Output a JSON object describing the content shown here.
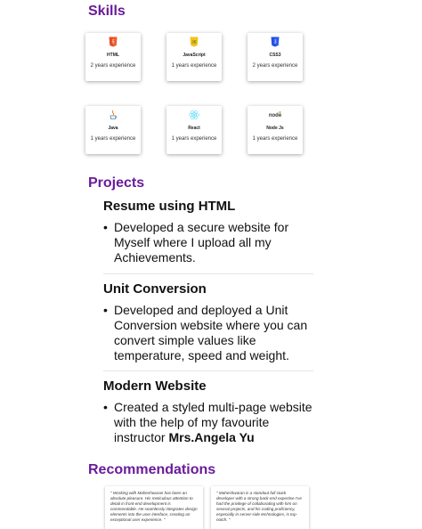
{
  "skills": {
    "title": "Skills",
    "items": [
      {
        "name": "HTML",
        "experience": "2 years experience",
        "icon": "html5-icon",
        "color": "#e44d26"
      },
      {
        "name": "JavaScript",
        "experience": "1 years experience",
        "icon": "javascript-icon",
        "color": "#f0c419"
      },
      {
        "name": "CSS3",
        "experience": "2 years experience",
        "icon": "css3-icon",
        "color": "#264de4"
      },
      {
        "name": "Java",
        "experience": "1 years experience",
        "icon": "java-icon",
        "color": "#e76f00"
      },
      {
        "name": "React",
        "experience": "1 years experience",
        "icon": "react-icon",
        "color": "#61dafb"
      },
      {
        "name": "Node Js",
        "experience": "1 years experience",
        "icon": "nodejs-icon",
        "color": "#333333"
      }
    ]
  },
  "projects": {
    "title": "Projects",
    "items": [
      {
        "title": "Resume using HTML",
        "bullet": "Developed a secure website for Myself where I upload all my Achievements."
      },
      {
        "title": "Unit Conversion",
        "bullet": "Developed and deployed a Unit Conversion website where you can convert simple values like temperature, speed and weight."
      },
      {
        "title": "Modern Website",
        "bullet": "Created a styled multi-page website with the help of my favourite instructor ",
        "bullet_bold": "Mrs.Angela Yu"
      }
    ]
  },
  "recommendations": {
    "title": "Recommendations",
    "items": [
      {
        "text": "\" Working with Maheshwaran has been an absolute pleasure. His meticulous attention to detail in front-end development is commendable. He seamlessly integrates design elements into the user interface, creating an exceptional user experience. \""
      },
      {
        "text": "\" Maheshwaran is a standout full stack developer with a strong back-end expertise I've had the privilege of collaborating with him on several projects, and his coding proficiency, especially in server-side technologies, is top-notch. \""
      }
    ]
  },
  "colors": {
    "accent": "#6a1b9a"
  }
}
